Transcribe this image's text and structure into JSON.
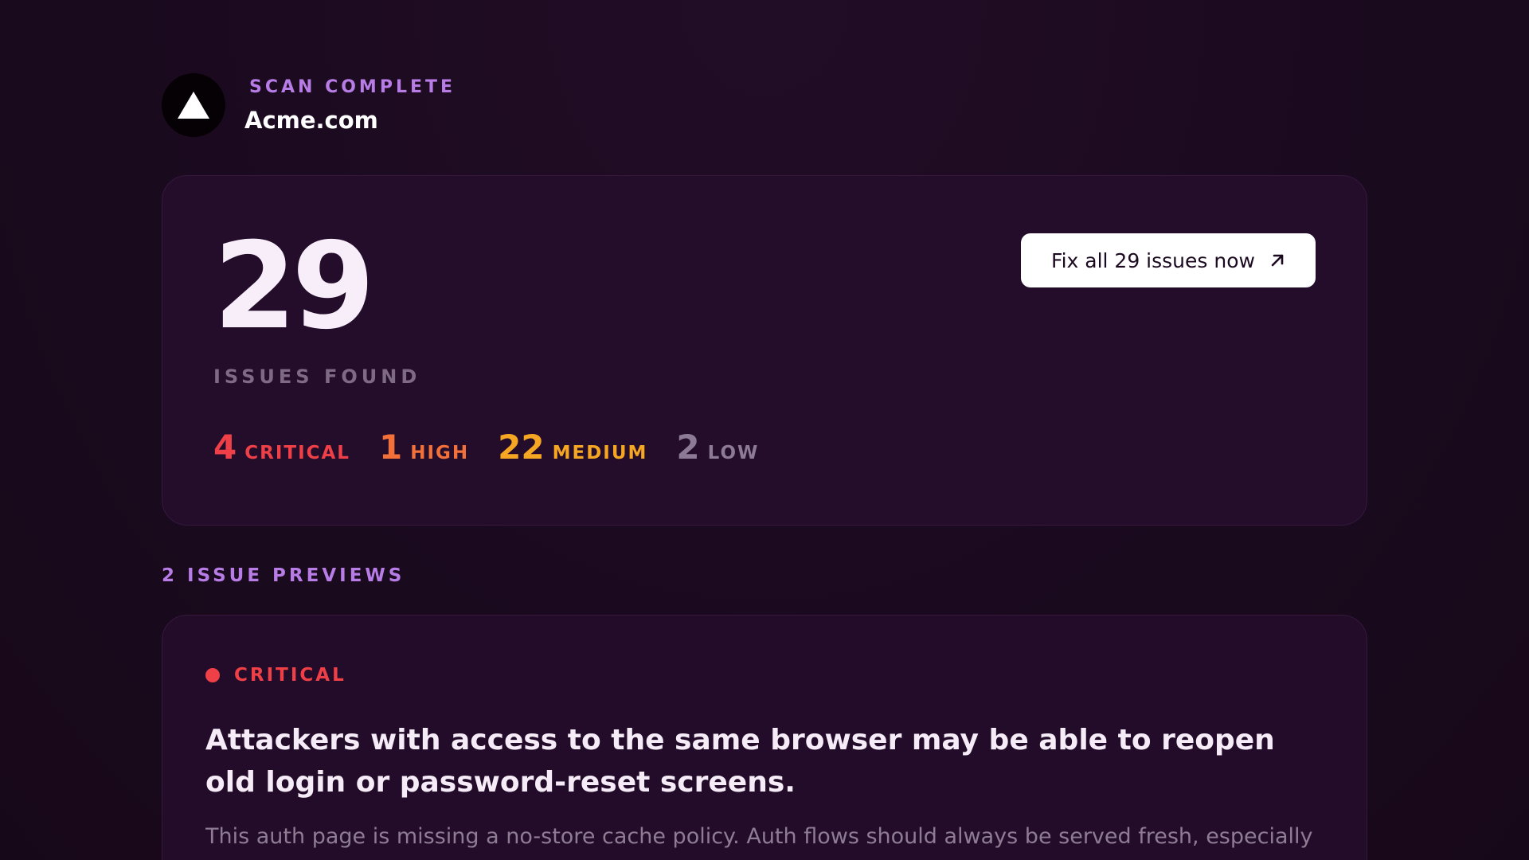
{
  "header": {
    "status_label": "SCAN COMPLETE",
    "site_name": "Acme.com",
    "logo_icon": "triangle-logo-icon"
  },
  "summary": {
    "total_count": "29",
    "total_label": "ISSUES FOUND",
    "fix_button_label": "Fix all 29 issues now",
    "fix_button_icon": "arrow-up-right-icon",
    "severities": [
      {
        "count": "4",
        "label": "CRITICAL",
        "color": "#ef4048"
      },
      {
        "count": "1",
        "label": "HIGH",
        "color": "#f2703a"
      },
      {
        "count": "22",
        "label": "MEDIUM",
        "color": "#f5a623"
      },
      {
        "count": "2",
        "label": "LOW",
        "color": "#8d7a96"
      }
    ]
  },
  "previews": {
    "heading": "2 ISSUE PREVIEWS",
    "items": [
      {
        "severity": "CRITICAL",
        "severity_color": "#ef4048",
        "title": "Attackers with access to the same browser may be able to reopen old login or password-reset screens.",
        "description": "This auth page is missing a no-store cache policy. Auth flows should always be served fresh, especially"
      }
    ]
  }
}
